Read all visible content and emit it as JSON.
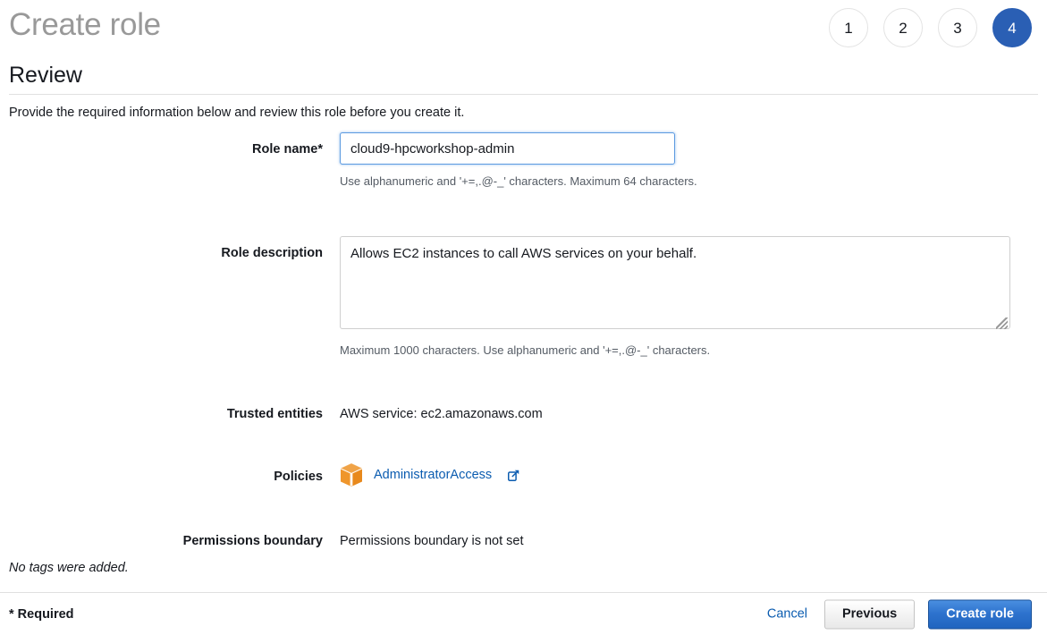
{
  "header": {
    "title": "Create role",
    "section_title": "Review",
    "intro": "Provide the required information below and review this role before you create it.",
    "steps": [
      {
        "label": "1",
        "active": false
      },
      {
        "label": "2",
        "active": false
      },
      {
        "label": "3",
        "active": false
      },
      {
        "label": "4",
        "active": true
      }
    ],
    "active_step_color": "#2a5fb4"
  },
  "form": {
    "role_name": {
      "label": "Role name*",
      "value": "cloud9-hpcworkshop-admin",
      "placeholder": "",
      "helper": "Use alphanumeric and '+=,.@-_' characters. Maximum 64 characters."
    },
    "role_description": {
      "label": "Role description",
      "value": "Allows EC2 instances to call AWS services on your behalf.",
      "placeholder": "",
      "helper": "Maximum 1000 characters. Use alphanumeric and '+=,.@-_' characters."
    },
    "trusted_entities": {
      "label": "Trusted entities",
      "value": "AWS service: ec2.amazonaws.com"
    },
    "policies": {
      "label": "Policies",
      "icon": "policy-cube-icon",
      "icon_color": "#f0962c",
      "link_text": "AdministratorAccess",
      "link_color": "#0b5cb0",
      "external_icon": "external-link-icon"
    },
    "permissions_boundary": {
      "label": "Permissions boundary",
      "value": "Permissions boundary is not set"
    },
    "tags_note": "No tags were added."
  },
  "footer": {
    "required_note": "* Required",
    "cancel_label": "Cancel",
    "previous_label": "Previous",
    "create_label": "Create role",
    "primary_color": "#2064bf"
  }
}
